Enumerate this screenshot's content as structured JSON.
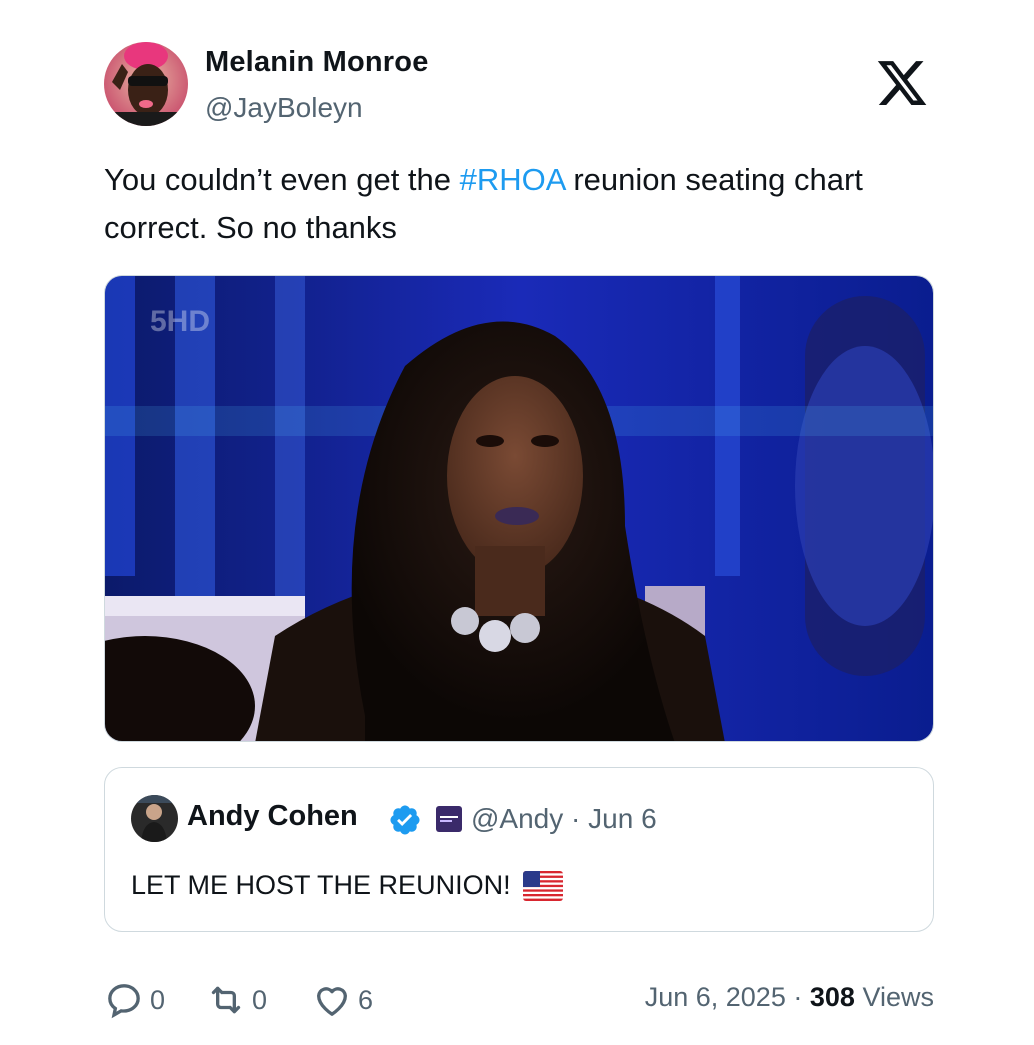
{
  "author": {
    "name": "Melanin Monroe",
    "handle": "@JayBoleyn"
  },
  "tweet": {
    "text_before": "You couldn’t even get the ",
    "hashtag": "#RHOA",
    "text_after": "  reunion seating chart correct. So no thanks"
  },
  "media": {
    "watermark": "5HD"
  },
  "quote": {
    "name": "Andy Cohen",
    "handle": "@Andy",
    "separator": "·",
    "date": "Jun 6",
    "text": "LET ME HOST THE REUNION!"
  },
  "actions": {
    "replies": "0",
    "retweets": "0",
    "likes": "6"
  },
  "footer": {
    "date": "Jun 6, 2025",
    "separator": "·",
    "views_count": "308",
    "views_label": "Views"
  },
  "colors": {
    "link": "#1d9bf0",
    "secondary_text": "#536471",
    "border": "#cfd9de"
  }
}
